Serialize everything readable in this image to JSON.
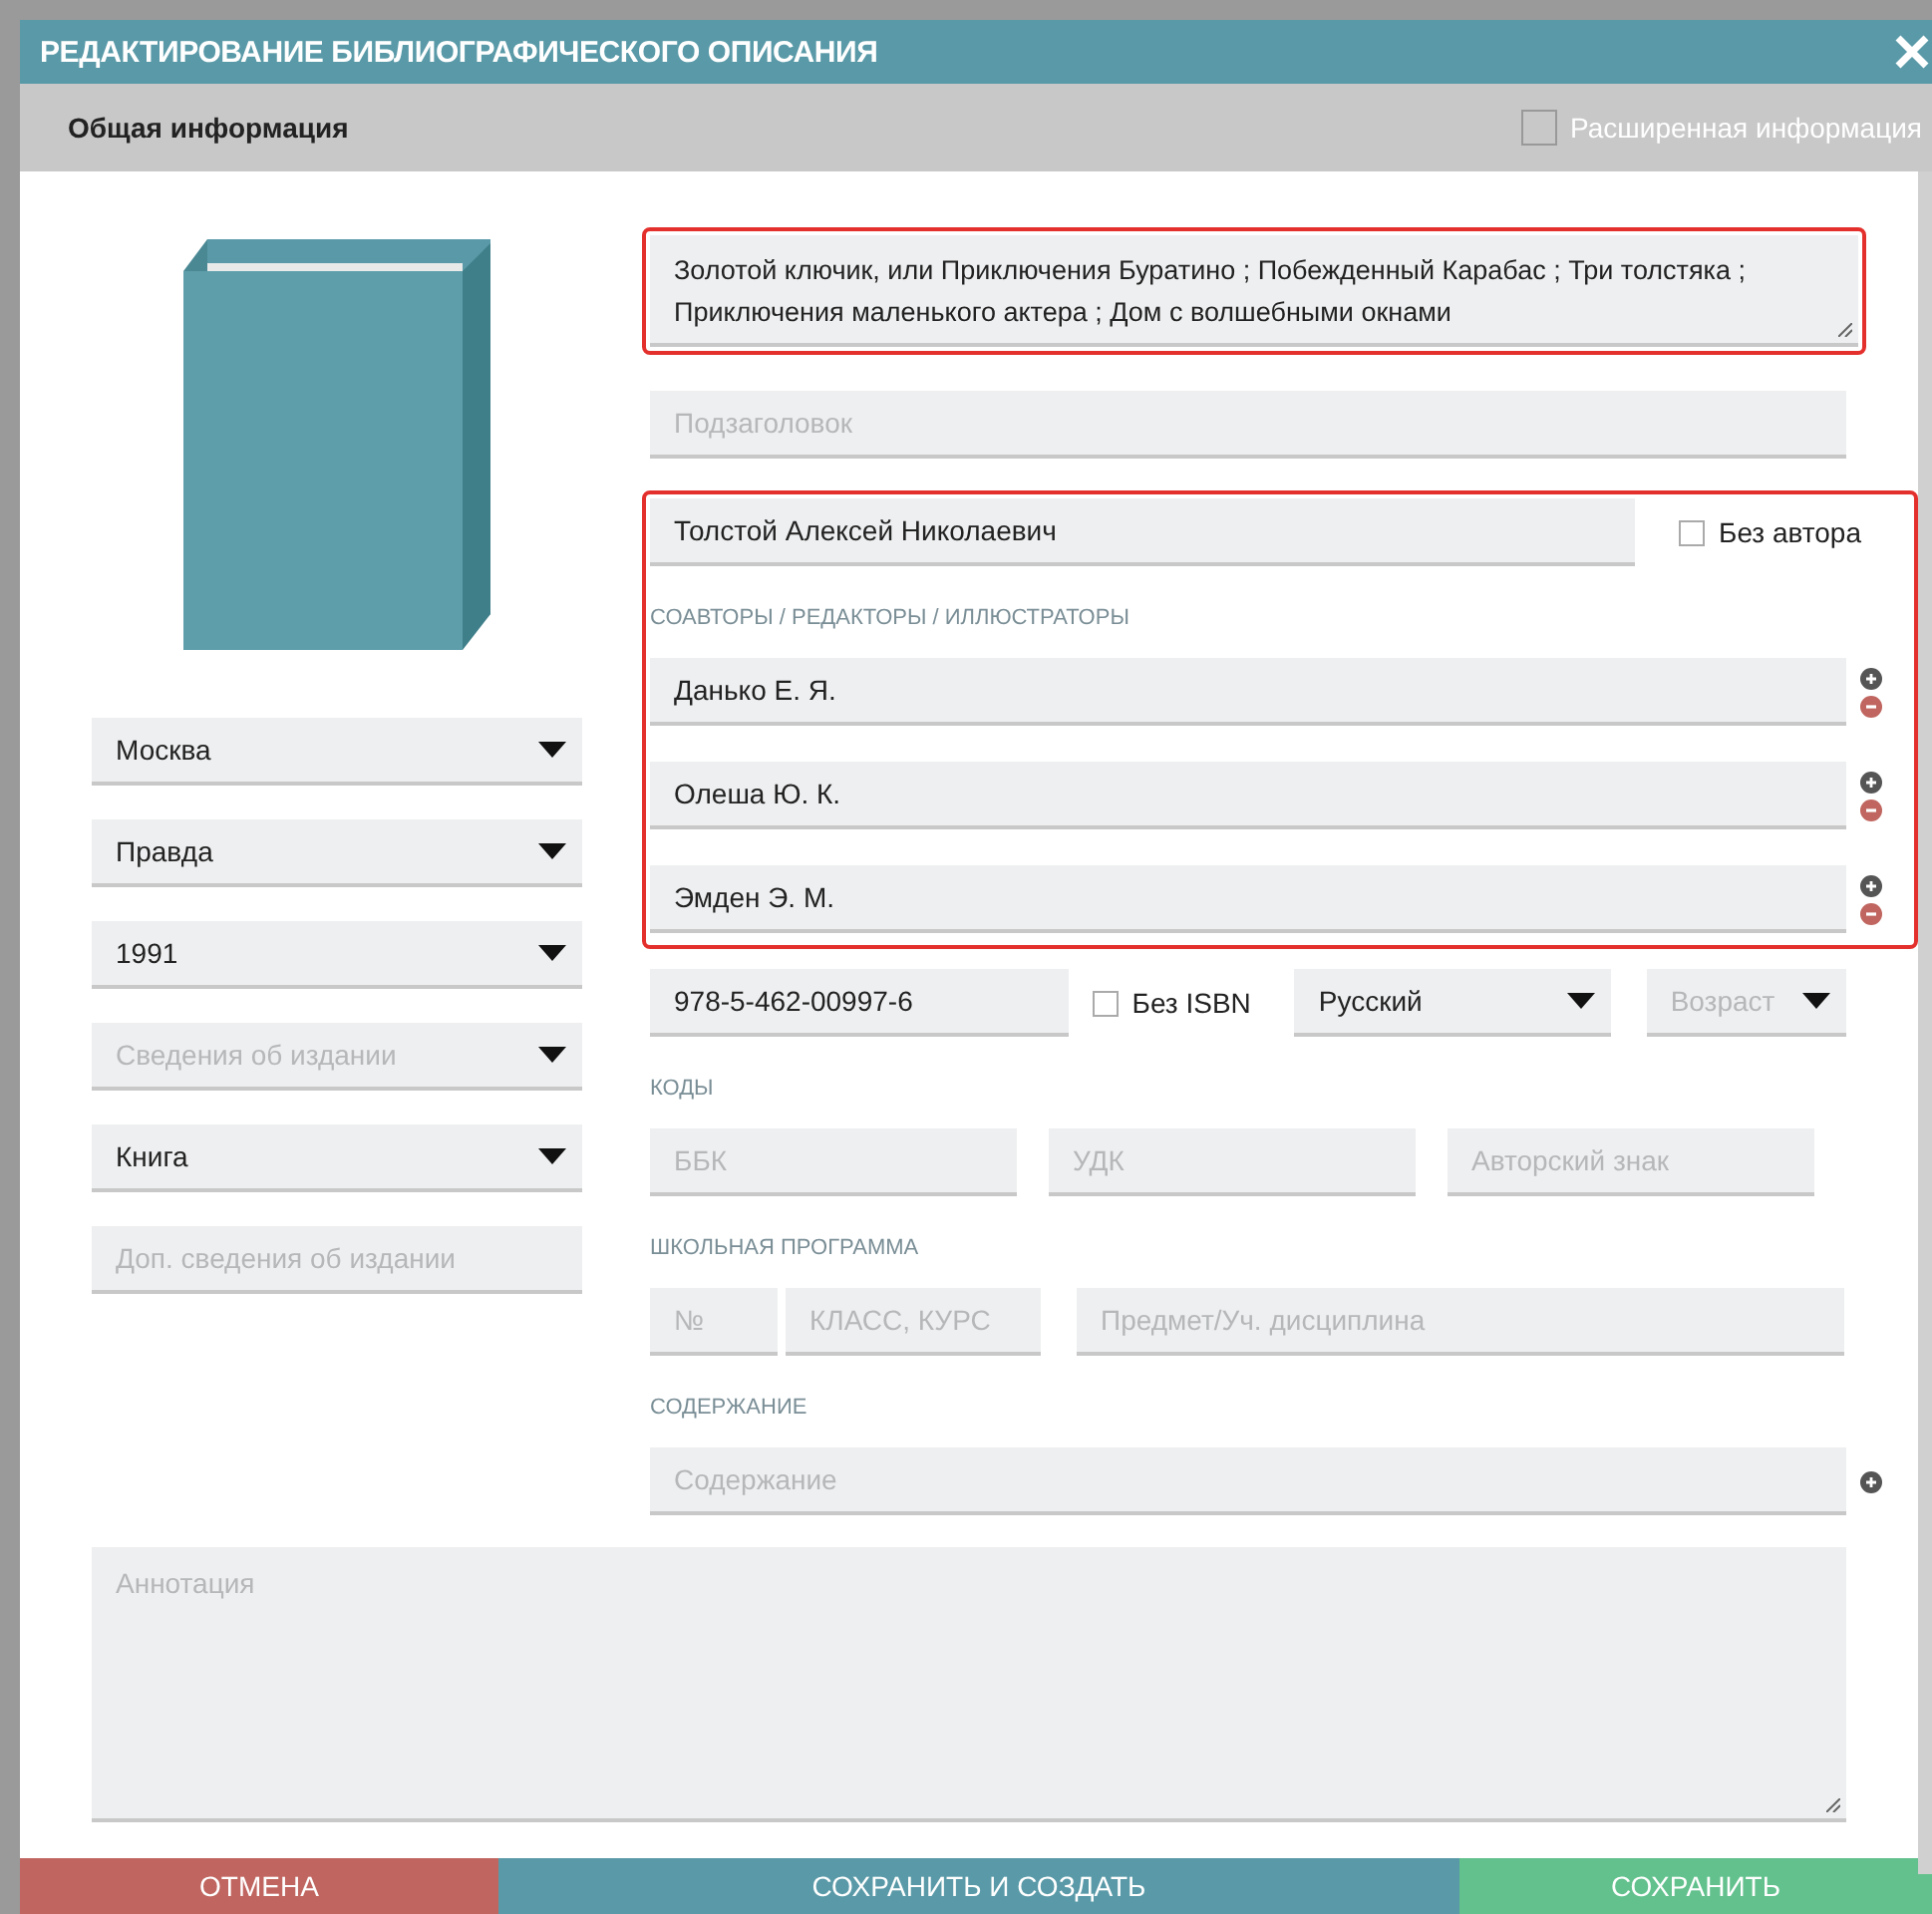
{
  "window": {
    "title": "РЕДАКТИРОВАНИЕ БИБЛИОГРАФИЧЕСКОГО ОПИСАНИЯ"
  },
  "subheader": {
    "title": "Общая информация",
    "extended": {
      "label": "Расширенная информация",
      "checked": false
    }
  },
  "left_fields": [
    {
      "kind": "select",
      "value": "Москва"
    },
    {
      "kind": "select",
      "value": "Правда"
    },
    {
      "kind": "select",
      "value": "1991"
    },
    {
      "kind": "select",
      "placeholder": "Сведения об издании"
    },
    {
      "kind": "select",
      "value": "Книга"
    },
    {
      "kind": "input",
      "placeholder": "Доп. сведения об издании"
    }
  ],
  "title_field": {
    "value": "Золотой ключик, или Приключения Буратино ; Побежденный Карабас ; Три толстяка ; Приключения маленького актера ; Дом с волшебными окнами",
    "highlighted": true
  },
  "subtitle_field": {
    "placeholder": "Подзаголовок"
  },
  "authors": {
    "highlighted": true,
    "author": "Толстой Алексей Николаевич",
    "no_author": {
      "label": "Без автора",
      "checked": false
    },
    "coauthors_label": "СОАВТОРЫ / РЕДАКТОРЫ / ИЛЛЮСТРАТОРЫ",
    "coauthors": [
      {
        "value": "Данько Е. Я."
      },
      {
        "value": "Олеша Ю. К."
      },
      {
        "value": "Эмден Э. М."
      }
    ]
  },
  "isbn": {
    "value": "978-5-462-00997-6",
    "no_isbn": {
      "label": "Без ISBN",
      "checked": false
    }
  },
  "language": {
    "value": "Русский"
  },
  "age": {
    "placeholder": "Возраст"
  },
  "codes": {
    "label": "КОДЫ",
    "fields": [
      {
        "placeholder": "ББК"
      },
      {
        "placeholder": "УДК"
      },
      {
        "placeholder": "Авторский знак"
      }
    ]
  },
  "school": {
    "label": "ШКОЛЬНАЯ ПРОГРАММА",
    "fields": [
      {
        "placeholder": "№"
      },
      {
        "placeholder": "КЛАСС, КУРС"
      },
      {
        "placeholder": "Предмет/Уч. дисциплина"
      }
    ]
  },
  "contents": {
    "label": "СОДЕРЖАНИЕ",
    "placeholder": "Содержание"
  },
  "annotation": {
    "placeholder": "Аннотация"
  },
  "buttons": [
    {
      "label": "ОТМЕНА",
      "color": "#c0655f"
    },
    {
      "label": "СОХРАНИТЬ И СОЗДАТЬ",
      "color": "#5a9aa8"
    },
    {
      "label": "СОХРАНИТЬ",
      "color": "#62c18d"
    }
  ]
}
